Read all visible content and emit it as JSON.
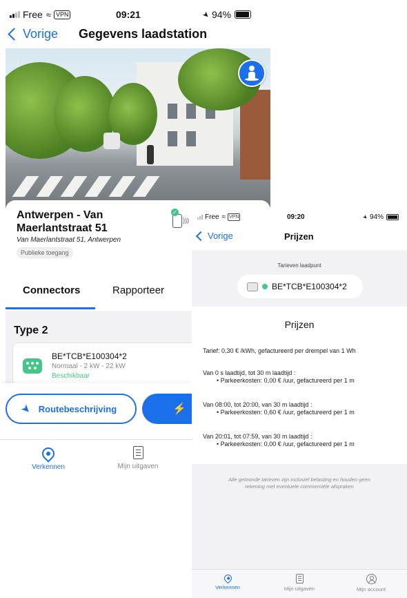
{
  "left": {
    "status": {
      "carrier": "Free",
      "vpn": "VPN",
      "time": "09:21",
      "battery": "94%"
    },
    "nav": {
      "back_label": "Vorige",
      "title": "Gegevens laadstation"
    },
    "station": {
      "name_line1": "Antwerpen - Van",
      "name_line2": "Maerlantstraat 51",
      "address": "Van Maerlantstraat 51, Antwerpen",
      "access_chip": "Publieke toegang"
    },
    "tabs": {
      "connectors": "Connectors",
      "report": "Rapporteer"
    },
    "connector_group": "Type 2",
    "connector": {
      "id": "BE*TCB*E100304*2",
      "specs": "Normaal - 2 kW - 22 kW",
      "status": "Beschikbaar"
    },
    "buttons": {
      "route": "Routebeschrijving"
    },
    "tabbar": {
      "explore": "Verkennen",
      "expenses": "Mijn uitgaven"
    }
  },
  "right": {
    "status": {
      "carrier": "Free",
      "vpn": "VPN",
      "time": "09:20",
      "battery": "94%"
    },
    "nav": {
      "back_label": "Vorige",
      "title": "Prijzen"
    },
    "rates_label": "Tarieven laadpunt",
    "connector_id": "BE*TCB*E100304*2",
    "prices_title": "Prijzen",
    "tariff": "Tarief: 0,30 € /kWh, gefactureerd per drempel van 1 Wh",
    "rules": [
      {
        "condition": "Van 0 s laadtijd, tot 30 m laadtijd :",
        "cost": "• Parkeerkosten: 0,00 € /uur, gefactureerd per 1 m"
      },
      {
        "condition": "Van 08:00, tot 20:00, van 30 m laadtijd :",
        "cost": "• Parkeerkosten: 0,60 € /uur, gefactureerd per 1 m"
      },
      {
        "condition": "Van 20:01, tot 07:59, van 30 m laadtijd :",
        "cost": "• Parkeerkosten: 0,00 € /uur, gefactureerd per 1 m"
      }
    ],
    "disclaimer_line1": "Alle getoonde tarieven zijn inclusief belasting en houden geen",
    "disclaimer_line2": "rekening met eventuele commerciële afspraken",
    "tabbar": {
      "explore": "Verkennen",
      "expenses": "Mijn uitgaven",
      "account": "Mijn account"
    }
  },
  "colors": {
    "accent": "#1b6fe8",
    "available": "#43c789",
    "background": "#f2f2f5"
  },
  "icons": [
    "signal-icon",
    "wifi-icon",
    "location-arrow-icon",
    "battery-icon",
    "chevron-left-icon",
    "street-view-icon",
    "charger-status-icon",
    "type2-socket-icon",
    "navigation-arrow-icon",
    "lightning-icon",
    "map-pin-icon",
    "receipt-icon",
    "account-icon"
  ]
}
